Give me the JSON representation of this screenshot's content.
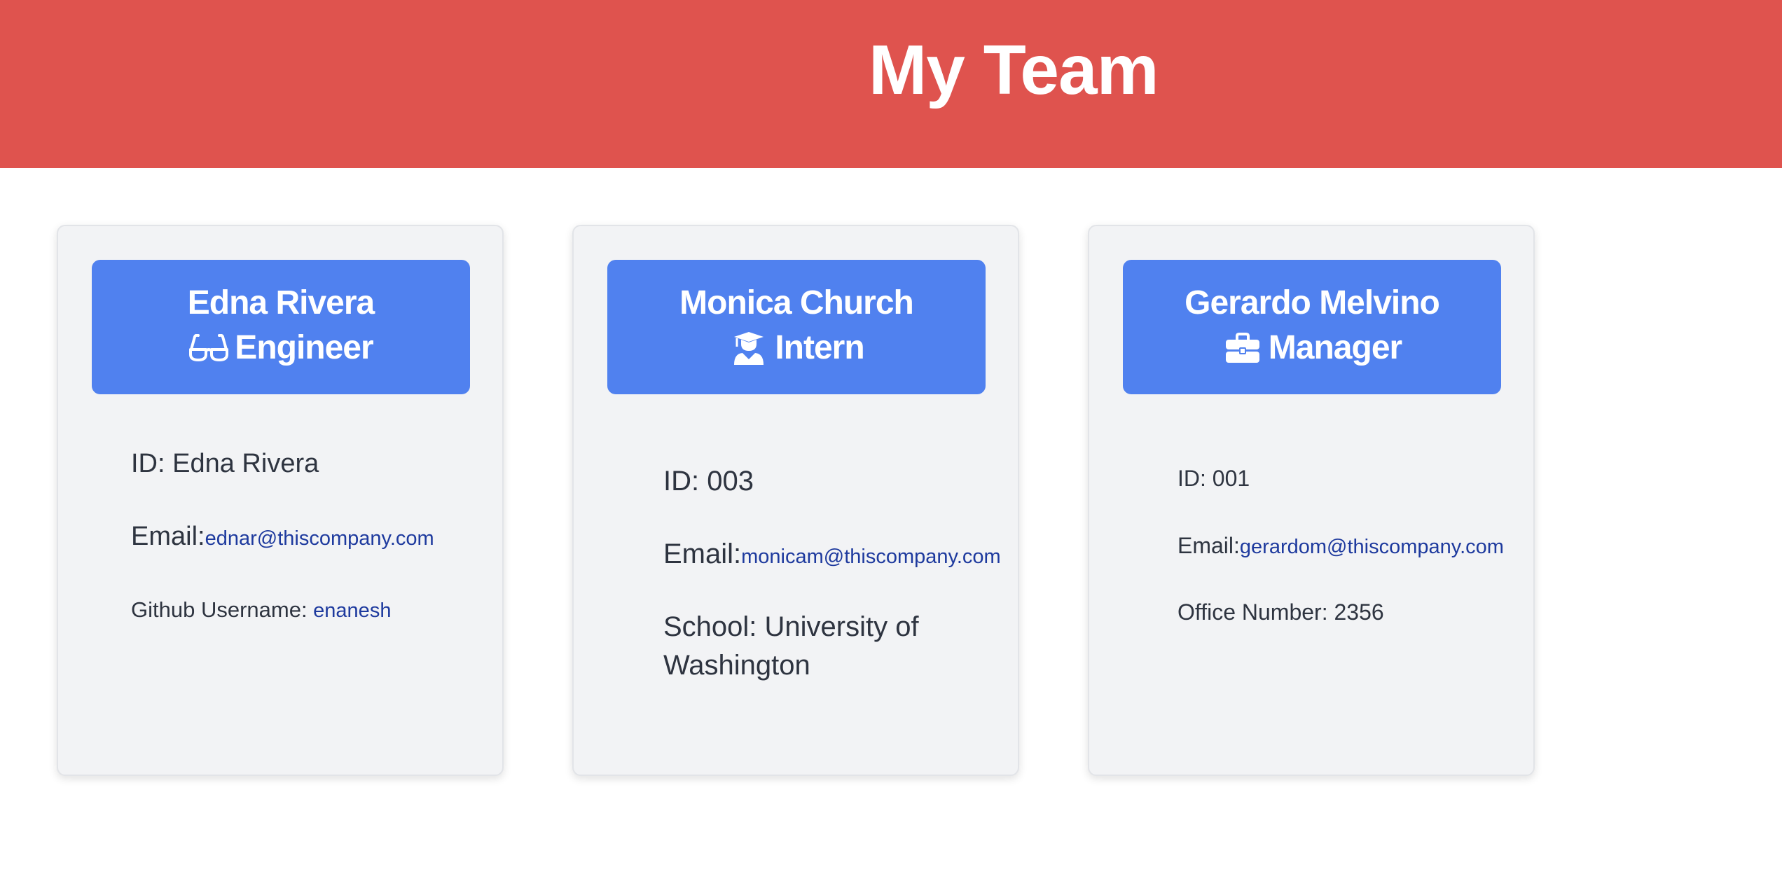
{
  "header": {
    "title": "My Team"
  },
  "colors": {
    "banner": "#df534e",
    "card_header": "#5081ef",
    "card_bg": "#f2f3f5",
    "link": "#1e3a9e"
  },
  "team": [
    {
      "name": "Edna Rivera",
      "role": "Engineer",
      "role_icon": "glasses-icon",
      "id_label": "ID: ",
      "id_value": "Edna Rivera",
      "email_label": "Email:",
      "email": "ednar@thiscompany.com",
      "extra_label": "Github Username: ",
      "extra_value": "enanesh"
    },
    {
      "name": "Monica Church",
      "role": "Intern",
      "role_icon": "graduate-icon",
      "id_label": "ID: ",
      "id_value": "003",
      "email_label": "Email:",
      "email": "monicam@thiscompany.com",
      "extra_label_line1": "School: University of",
      "extra_label_line2": "Washington"
    },
    {
      "name": "Gerardo Melvino",
      "role": "Manager",
      "role_icon": "briefcase-icon",
      "id_label": "ID: ",
      "id_value": "001",
      "email_label": "Email:",
      "email": "gerardom@thiscompany.com",
      "extra_label": "Office Number: ",
      "extra_value": "2356"
    }
  ]
}
